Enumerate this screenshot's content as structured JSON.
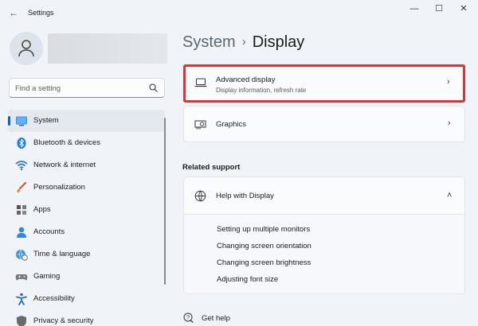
{
  "app": {
    "title": "Settings",
    "back_icon": "back-arrow-icon"
  },
  "window_controls": {
    "minimize": "—",
    "maximize": "☐",
    "close": "✕"
  },
  "search": {
    "placeholder": "Find a setting"
  },
  "nav": {
    "items": [
      {
        "label": "System",
        "icon": "monitor-icon",
        "active": true
      },
      {
        "label": "Bluetooth & devices",
        "icon": "bluetooth-icon"
      },
      {
        "label": "Network & internet",
        "icon": "wifi-icon"
      },
      {
        "label": "Personalization",
        "icon": "brush-icon"
      },
      {
        "label": "Apps",
        "icon": "apps-icon"
      },
      {
        "label": "Accounts",
        "icon": "person-icon"
      },
      {
        "label": "Time & language",
        "icon": "globe-clock-icon"
      },
      {
        "label": "Gaming",
        "icon": "controller-icon"
      },
      {
        "label": "Accessibility",
        "icon": "accessibility-icon"
      },
      {
        "label": "Privacy & security",
        "icon": "shield-icon"
      }
    ]
  },
  "breadcrumb": {
    "parent": "System",
    "separator": "›",
    "current": "Display"
  },
  "cards": {
    "advanced": {
      "title": "Advanced display",
      "subtitle": "Display information, refresh rate",
      "icon": "laptop-icon",
      "chevron": "›"
    },
    "graphics": {
      "title": "Graphics",
      "icon": "graphics-card-icon",
      "chevron": "›"
    }
  },
  "related": {
    "heading": "Related support",
    "help": {
      "title": "Help with Display",
      "icon": "globe-icon",
      "chevron": "˄"
    },
    "links": [
      "Setting up multiple monitors",
      "Changing screen orientation",
      "Changing screen brightness",
      "Adjusting font size"
    ]
  },
  "get_help": {
    "label": "Get help",
    "icon": "help-chat-icon"
  },
  "colors": {
    "accent": "#0067c0",
    "highlight": "#d9333b",
    "background": "#f0f4f9"
  }
}
